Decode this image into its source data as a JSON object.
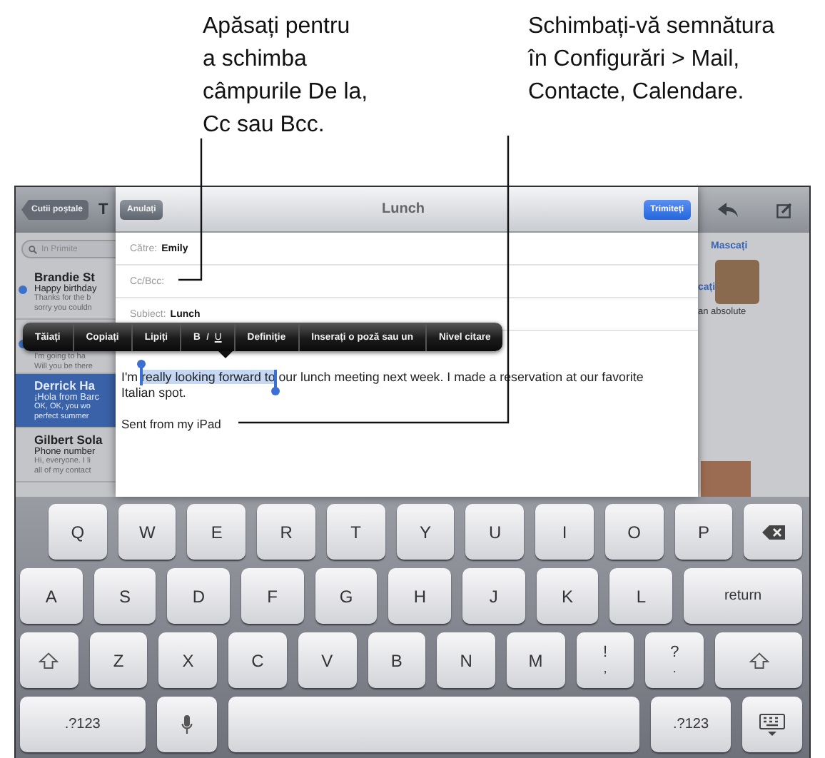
{
  "callouts": [
    {
      "lines": [
        "Apăsați pentru",
        "a schimba",
        "câmpurile De la,",
        "Cc sau Bcc."
      ]
    },
    {
      "lines": [
        "Schimbați-vă semnătura",
        "în Configurări > Mail,",
        "Contacte, Calendare."
      ]
    }
  ],
  "mailbox_list": {
    "back_button": "Cutii poștale",
    "title": "T",
    "search": {
      "placeholder": "In Primite"
    },
    "messages": [
      {
        "sender": "Brandie St",
        "subject": "Happy birthday",
        "preview": [
          "Thanks for the b",
          "sorry you couldn"
        ],
        "unread": true,
        "selected": false
      },
      {
        "preview": [
          "I'm going to ha",
          "Will you be there"
        ],
        "unread": true,
        "selected": false
      },
      {
        "sender": "Derrick Ha",
        "subject": "¡Hola from Barc",
        "preview": [
          "OK, OK, you wo",
          "perfect summer"
        ],
        "unread": false,
        "selected": true
      },
      {
        "sender": "Gilbert Sola",
        "subject": "Phone number",
        "preview": [
          "Hi, everyone. I li",
          "all of my contact"
        ],
        "unread": false,
        "selected": false
      }
    ]
  },
  "compose": {
    "cancel_button": "Anulați",
    "title": "Lunch",
    "send_button": "Trimiteți",
    "fields": [
      {
        "label": "Către:",
        "value": "Emily"
      },
      {
        "label": "Cc/Bcc:"
      },
      {
        "label": "Subiect:",
        "value": "Lunch"
      }
    ],
    "body": {
      "before": "I'm ",
      "selected_text": "really looking forward to",
      "after": " our lunch meeting next week. I made a reservation at our favorite Italian spot.",
      "signature": "Sent from my iPad"
    }
  },
  "edit_menu": {
    "items": [
      {
        "kind": "text",
        "label": "Tăiați"
      },
      {
        "kind": "text",
        "label": "Copiați"
      },
      {
        "kind": "text",
        "label": "Lipiți"
      },
      {
        "kind": "format",
        "letters": [
          "B",
          "I",
          "U"
        ]
      },
      {
        "kind": "text",
        "label": "Definiție"
      },
      {
        "kind": "text",
        "label": "Inserați o poză sau un"
      },
      {
        "kind": "text",
        "label": "Nivel citare"
      }
    ]
  },
  "message_pane": {
    "hide_button": "Mascați",
    "partial_link": "cați",
    "partial_text": "an absolute"
  },
  "keyboard": {
    "key_rows": [
      {
        "keys": [
          {
            "kind": "letter",
            "label": "Q"
          },
          {
            "kind": "letter",
            "label": "W"
          },
          {
            "kind": "letter",
            "label": "E"
          },
          {
            "kind": "letter",
            "label": "R"
          },
          {
            "kind": "letter",
            "label": "T"
          },
          {
            "kind": "letter",
            "label": "Y"
          },
          {
            "kind": "letter",
            "label": "U"
          },
          {
            "kind": "letter",
            "label": "I"
          },
          {
            "kind": "letter",
            "label": "O"
          },
          {
            "kind": "letter",
            "label": "P"
          },
          {
            "kind": "backspace"
          }
        ]
      },
      {
        "keys": [
          {
            "kind": "letter",
            "label": "A"
          },
          {
            "kind": "letter",
            "label": "S"
          },
          {
            "kind": "letter",
            "label": "D"
          },
          {
            "kind": "letter",
            "label": "F"
          },
          {
            "kind": "letter",
            "label": "G"
          },
          {
            "kind": "letter",
            "label": "H"
          },
          {
            "kind": "letter",
            "label": "J"
          },
          {
            "kind": "letter",
            "label": "K"
          },
          {
            "kind": "letter",
            "label": "L"
          },
          {
            "kind": "return",
            "label": "return"
          }
        ]
      },
      {
        "keys": [
          {
            "kind": "shift"
          },
          {
            "kind": "letter",
            "label": "Z"
          },
          {
            "kind": "letter",
            "label": "X"
          },
          {
            "kind": "letter",
            "label": "C"
          },
          {
            "kind": "letter",
            "label": "V"
          },
          {
            "kind": "letter",
            "label": "B"
          },
          {
            "kind": "letter",
            "label": "N"
          },
          {
            "kind": "letter",
            "label": "M"
          },
          {
            "kind": "dual",
            "label": "!",
            "sub": ","
          },
          {
            "kind": "dual",
            "label": "?",
            "sub": "."
          },
          {
            "kind": "shift"
          }
        ]
      },
      {
        "keys": [
          {
            "kind": "mode",
            "label": ".?123"
          },
          {
            "kind": "mic"
          },
          {
            "kind": "space"
          },
          {
            "kind": "mode",
            "label": ".?123"
          },
          {
            "kind": "dismiss"
          }
        ]
      }
    ]
  }
}
